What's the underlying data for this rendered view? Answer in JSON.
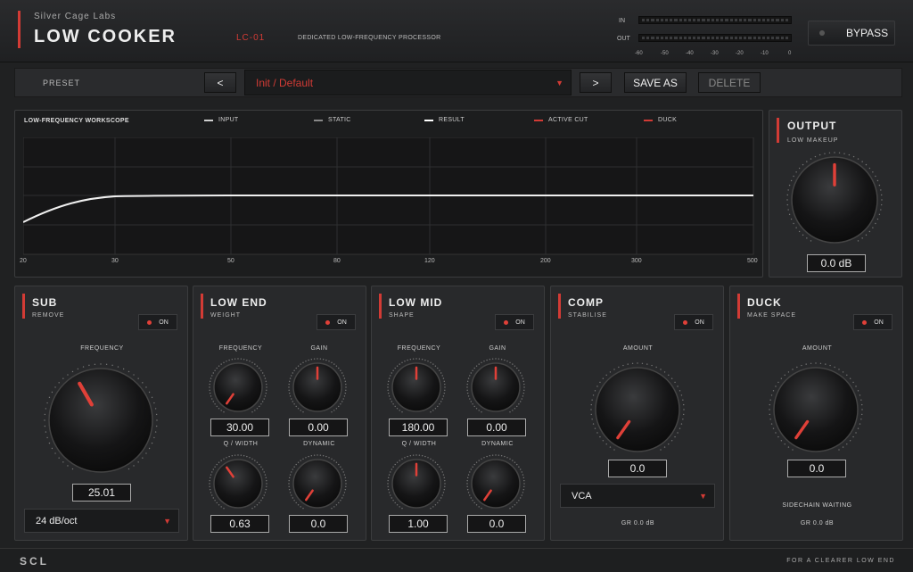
{
  "header": {
    "company": "Silver Cage Labs",
    "product": "LOW COOKER",
    "model": "LC-01",
    "description": "DEDICATED LOW-FREQUENCY PROCESSOR",
    "meter_in": "IN",
    "meter_out": "OUT",
    "ticks": [
      "-60",
      "-50",
      "-40",
      "-30",
      "-20",
      "-10",
      "0"
    ],
    "bypass": "BYPASS"
  },
  "preset": {
    "label": "PRESET",
    "prev": "<",
    "next": ">",
    "value": "Init / Default",
    "save_as": "SAVE AS",
    "delete": "DELETE"
  },
  "scope": {
    "title": "LOW-FREQUENCY WORKSCOPE",
    "legend": [
      {
        "name": "INPUT",
        "color": "#cfcfcf"
      },
      {
        "name": "STATIC",
        "color": "#888888"
      },
      {
        "name": "RESULT",
        "color": "#ffffff"
      },
      {
        "name": "ACTIVE CUT",
        "color": "#d23b35"
      },
      {
        "name": "DUCK",
        "color": "#d23b35"
      }
    ],
    "x_ticks": [
      "20",
      "30",
      "50",
      "80",
      "120",
      "200",
      "300",
      "500"
    ]
  },
  "output": {
    "title": "OUTPUT",
    "subtitle": "LOW MAKEUP",
    "value": "0.0 dB"
  },
  "sub": {
    "title": "SUB",
    "subtitle": "REMOVE",
    "toggle": "ON",
    "freq_label": "FREQUENCY",
    "freq_value": "25.01",
    "slope": "24 dB/oct"
  },
  "low_end": {
    "title": "LOW END",
    "subtitle": "WEIGHT",
    "toggle": "ON",
    "freq_label": "FREQUENCY",
    "freq_value": "30.00",
    "gain_label": "GAIN",
    "gain_value": "0.00",
    "q_label": "Q / WIDTH",
    "q_value": "0.63",
    "dyn_label": "DYNAMIC",
    "dyn_value": "0.0"
  },
  "low_mid": {
    "title": "LOW MID",
    "subtitle": "SHAPE",
    "toggle": "ON",
    "freq_label": "FREQUENCY",
    "freq_value": "180.00",
    "gain_label": "GAIN",
    "gain_value": "0.00",
    "q_label": "Q / WIDTH",
    "q_value": "1.00",
    "dyn_label": "DYNAMIC",
    "dyn_value": "0.0"
  },
  "comp": {
    "title": "COMP",
    "subtitle": "STABILISE",
    "toggle": "ON",
    "amount_label": "AMOUNT",
    "amount_value": "0.0",
    "mode": "VCA",
    "gr": "GR  0.0 dB"
  },
  "duck": {
    "title": "DUCK",
    "subtitle": "MAKE SPACE",
    "toggle": "ON",
    "amount_label": "AMOUNT",
    "amount_value": "0.0",
    "sidechain": "SIDECHAIN  WAITING",
    "gr": "GR  0.0 dB"
  },
  "footer": {
    "brand": "SCL",
    "tagline": "FOR A CLEARER LOW END"
  },
  "colors": {
    "accent": "#d23b35",
    "panel": "#28292b",
    "background": "#202122"
  }
}
